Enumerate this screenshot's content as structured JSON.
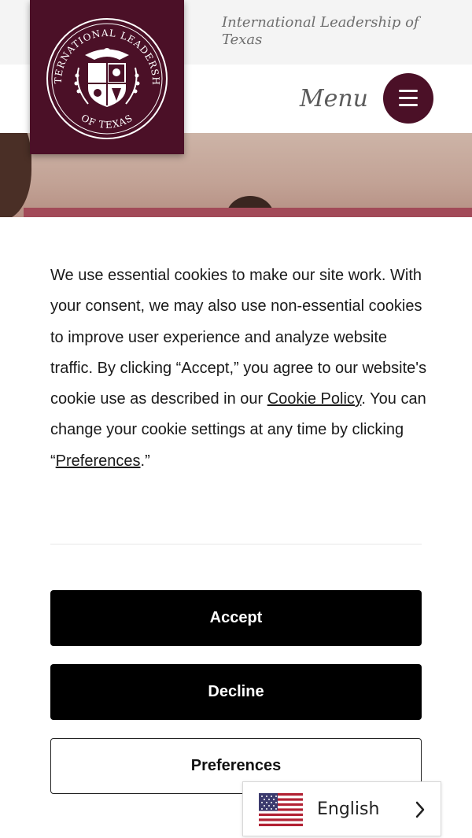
{
  "header": {
    "org_name": "International Leadership of Texas",
    "menu_label": "Menu"
  },
  "logo": {
    "seal_text_top": "INTERNATIONAL LEADERSHIP",
    "seal_text_bottom": "OF TEXAS"
  },
  "cookie_banner": {
    "text_part1": "We use essential cookies to make our site work. With your consent, we may also use non-essential cookies to improve user experience and analyze website traffic. By clicking “Accept,” you agree to our website's cookie use as described in our ",
    "cookie_policy_link": "Cookie Policy",
    "text_part2": ". You can change your cookie settings at any time by clicking “",
    "preferences_link": "Preferences",
    "text_part3": ".”",
    "accept_label": "Accept",
    "decline_label": "Decline",
    "preferences_label": "Preferences"
  },
  "language_selector": {
    "label": "English",
    "flag_icon": "us-flag-icon",
    "chevron_icon": "chevron-right-icon"
  },
  "colors": {
    "brand_maroon": "#4b1027",
    "button_dark": "#000000"
  }
}
